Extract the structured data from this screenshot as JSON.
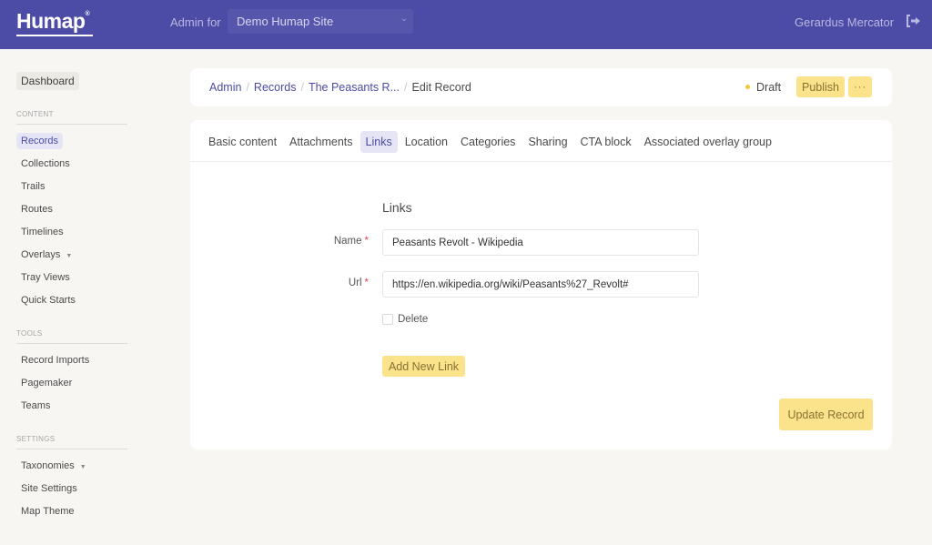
{
  "header": {
    "logo": "Humap",
    "admin_for_label": "Admin for",
    "site_select_value": "Demo Humap Site",
    "user_name": "Gerardus Mercator",
    "logout_icon": "logout-icon"
  },
  "sidebar": {
    "dashboard": "Dashboard",
    "sections": [
      {
        "title": "CONTENT",
        "items": [
          {
            "label": "Records",
            "active": true
          },
          {
            "label": "Collections"
          },
          {
            "label": "Trails"
          },
          {
            "label": "Routes"
          },
          {
            "label": "Timelines"
          },
          {
            "label": "Overlays",
            "has_caret": true
          },
          {
            "label": "Tray Views"
          },
          {
            "label": "Quick Starts"
          }
        ]
      },
      {
        "title": "TOOLS",
        "items": [
          {
            "label": "Record Imports"
          },
          {
            "label": "Pagemaker"
          },
          {
            "label": "Teams"
          }
        ]
      },
      {
        "title": "SETTINGS",
        "items": [
          {
            "label": "Taxonomies",
            "has_caret": true
          },
          {
            "label": "Site Settings"
          },
          {
            "label": "Map Theme"
          }
        ]
      }
    ]
  },
  "breadcrumb": {
    "items": [
      "Admin",
      "Records",
      "The Peasants R..."
    ],
    "current": "Edit Record"
  },
  "record_status": "Draft",
  "actions": {
    "publish": "Publish",
    "more": "···"
  },
  "tabs": [
    {
      "label": "Basic content"
    },
    {
      "label": "Attachments"
    },
    {
      "label": "Links",
      "active": true
    },
    {
      "label": "Location"
    },
    {
      "label": "Categories"
    },
    {
      "label": "Sharing"
    },
    {
      "label": "CTA block"
    },
    {
      "label": "Associated overlay group"
    }
  ],
  "form": {
    "title": "Links",
    "name_label": "Name",
    "name_value": "Peasants Revolt - Wikipedia",
    "url_label": "Url",
    "url_value": "https://en.wikipedia.org/wiki/Peasants%27_Revolt#",
    "required_mark": "*",
    "delete_label": "Delete",
    "delete_checked": false,
    "add_link_label": "Add New Link",
    "update_label": "Update Record"
  },
  "colors": {
    "brand": "#4c4ba6",
    "accent_yellow": "#fbe38c",
    "draft_dot": "#f0c93a",
    "required": "#e0415c"
  }
}
